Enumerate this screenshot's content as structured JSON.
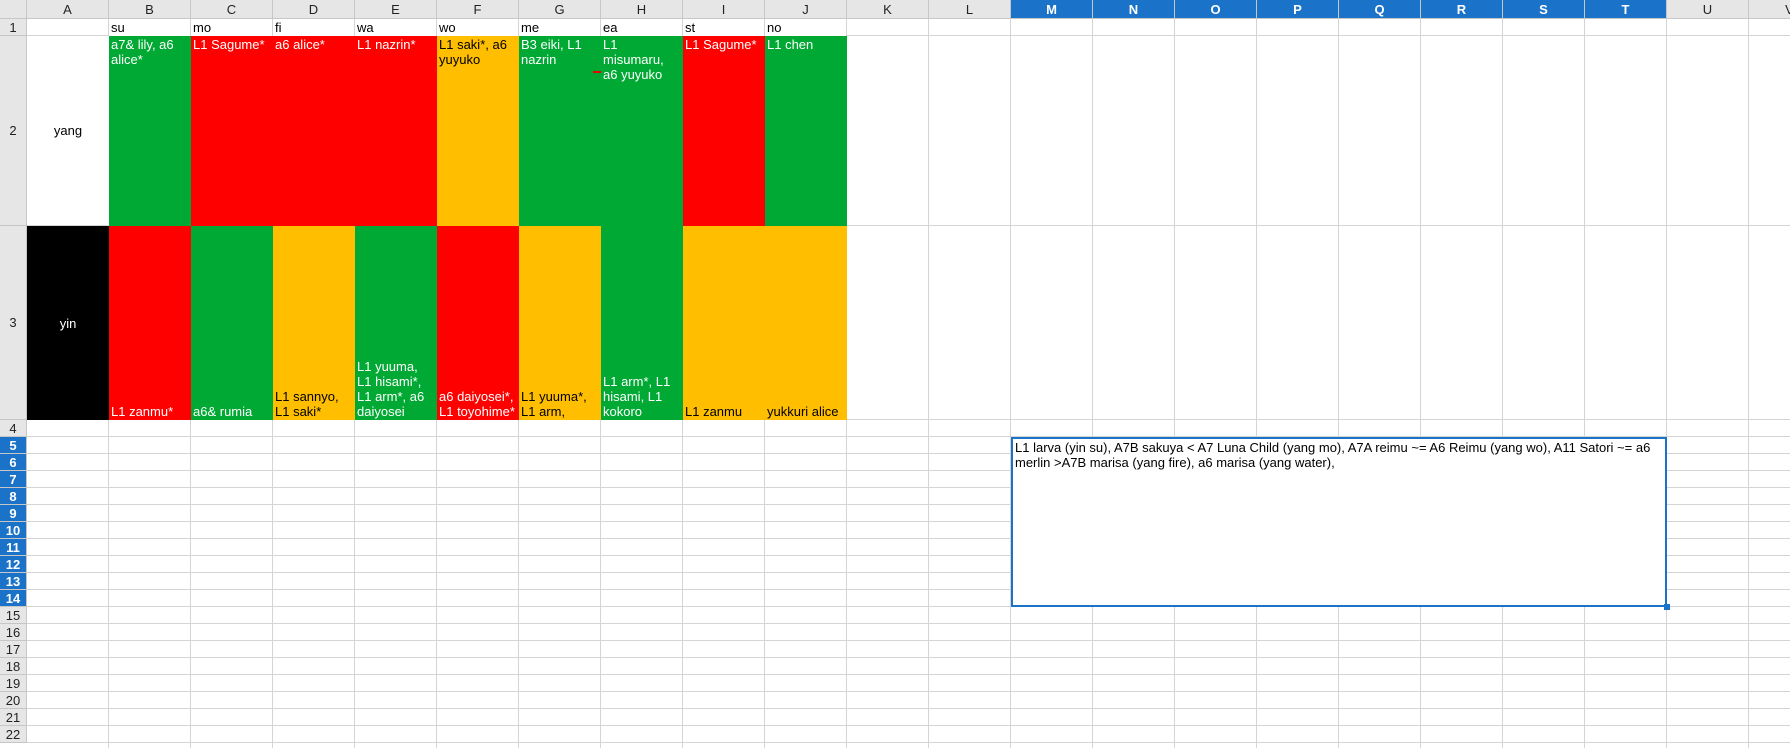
{
  "columns": [
    "A",
    "B",
    "C",
    "D",
    "E",
    "F",
    "G",
    "H",
    "I",
    "J",
    "K",
    "L",
    "M",
    "N",
    "O",
    "P",
    "Q",
    "R",
    "S",
    "T",
    "U",
    "V"
  ],
  "selected_columns": [
    "M",
    "N",
    "O",
    "P",
    "Q",
    "R",
    "S",
    "T"
  ],
  "rows": [
    "1",
    "2",
    "3",
    "4",
    "5",
    "6",
    "7",
    "8",
    "9",
    "10",
    "11",
    "12",
    "13",
    "14",
    "15",
    "16",
    "17",
    "18",
    "19",
    "20",
    "21",
    "22"
  ],
  "selected_rows": [
    "5",
    "6",
    "7",
    "8",
    "9",
    "10",
    "11",
    "12",
    "13",
    "14"
  ],
  "colors": {
    "green": "#00a933",
    "red": "#ff0000",
    "orange": "#ffbf00",
    "black": "#000000",
    "selection": "#1a73c8"
  },
  "sheet": {
    "header_row": [
      "su",
      "mo",
      "fi",
      "wa",
      "wo",
      "me",
      "ea",
      "st",
      "no"
    ],
    "row2": {
      "label": "yang",
      "cells": [
        {
          "text": "a7& lily, a6 alice*",
          "color": "green",
          "text_color": "#ffffff"
        },
        {
          "text": "L1 Sagume*",
          "color": "red",
          "text_color": "#ffffff"
        },
        {
          "text": "a6 alice*",
          "color": "red",
          "text_color": "#ffffff"
        },
        {
          "text": "L1 nazrin*",
          "color": "red",
          "text_color": "#ffffff"
        },
        {
          "text": "L1 saki*, a6 yuyuko",
          "color": "orange",
          "text_color": "#000000"
        },
        {
          "text": "B3 eiki, L1 nazrin",
          "color": "green",
          "text_color": "#ffffff"
        },
        {
          "text": "L1 misumaru, a6 yuyuko",
          "color": "green",
          "text_color": "#ffffff"
        },
        {
          "text": "L1 Sagume*",
          "color": "red",
          "text_color": "#ffffff"
        },
        {
          "text": "L1 chen",
          "color": "green",
          "text_color": "#ffffff"
        }
      ]
    },
    "row3": {
      "label": "yin",
      "cells": [
        {
          "text": "L1 zanmu*",
          "color": "red",
          "text_color": "#ffffff"
        },
        {
          "text": "a6& rumia",
          "color": "green",
          "text_color": "#ffffff"
        },
        {
          "text": "L1 sannyo, L1 saki*",
          "color": "orange",
          "text_color": "#000000"
        },
        {
          "text": "L1 yuuma, L1 hisami*, L1 arm*, a6 daiyosei",
          "color": "green",
          "text_color": "#ffffff"
        },
        {
          "text": "a6 daiyosei*, L1 toyohime*",
          "color": "red",
          "text_color": "#ffffff"
        },
        {
          "text": "L1 yuuma*, L1 arm,",
          "color": "orange",
          "text_color": "#000000"
        },
        {
          "text": "L1 arm*, L1 hisami, L1 kokoro",
          "color": "green",
          "text_color": "#ffffff"
        },
        {
          "text": "L1 zanmu",
          "color": "orange",
          "text_color": "#000000"
        },
        {
          "text": "yukkuri alice",
          "color": "orange",
          "text_color": "#000000"
        }
      ]
    },
    "merged_note": "L1 larva (yin su), A7B sakuya < A7 Luna Child (yang mo), A7A reimu ~= A6 Reimu (yang wo), A11 Satori ~= a6 merlin >A7B marisa (yang fire), a6 marisa (yang water),"
  }
}
